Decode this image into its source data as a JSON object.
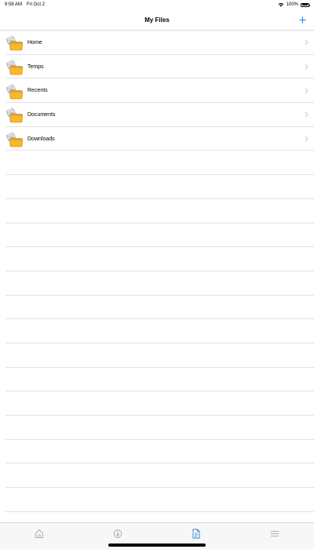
{
  "status_bar": {
    "time": "9:58 AM",
    "date": "Fri Oct 2",
    "battery_text": "100%",
    "icons": [
      "wifi-icon",
      "battery-icon"
    ]
  },
  "nav": {
    "title": "My Files",
    "add_icon": "plus-icon"
  },
  "folders": [
    {
      "label": "Home",
      "icon": "folder-icon"
    },
    {
      "label": "Temps",
      "icon": "folder-icon"
    },
    {
      "label": "Recents",
      "icon": "folder-icon"
    },
    {
      "label": "Documents",
      "icon": "folder-icon"
    },
    {
      "label": "Downloads",
      "icon": "folder-icon"
    }
  ],
  "tabs": [
    {
      "icon": "home-icon",
      "active": false
    },
    {
      "icon": "download-icon",
      "active": false
    },
    {
      "icon": "files-icon",
      "active": true
    },
    {
      "icon": "menu-icon",
      "active": false
    }
  ],
  "colors": {
    "accent": "#1a82e2",
    "tab_inactive": "#9a9a9a",
    "folder": "#f7b733",
    "separator": "#e2e2e6"
  }
}
